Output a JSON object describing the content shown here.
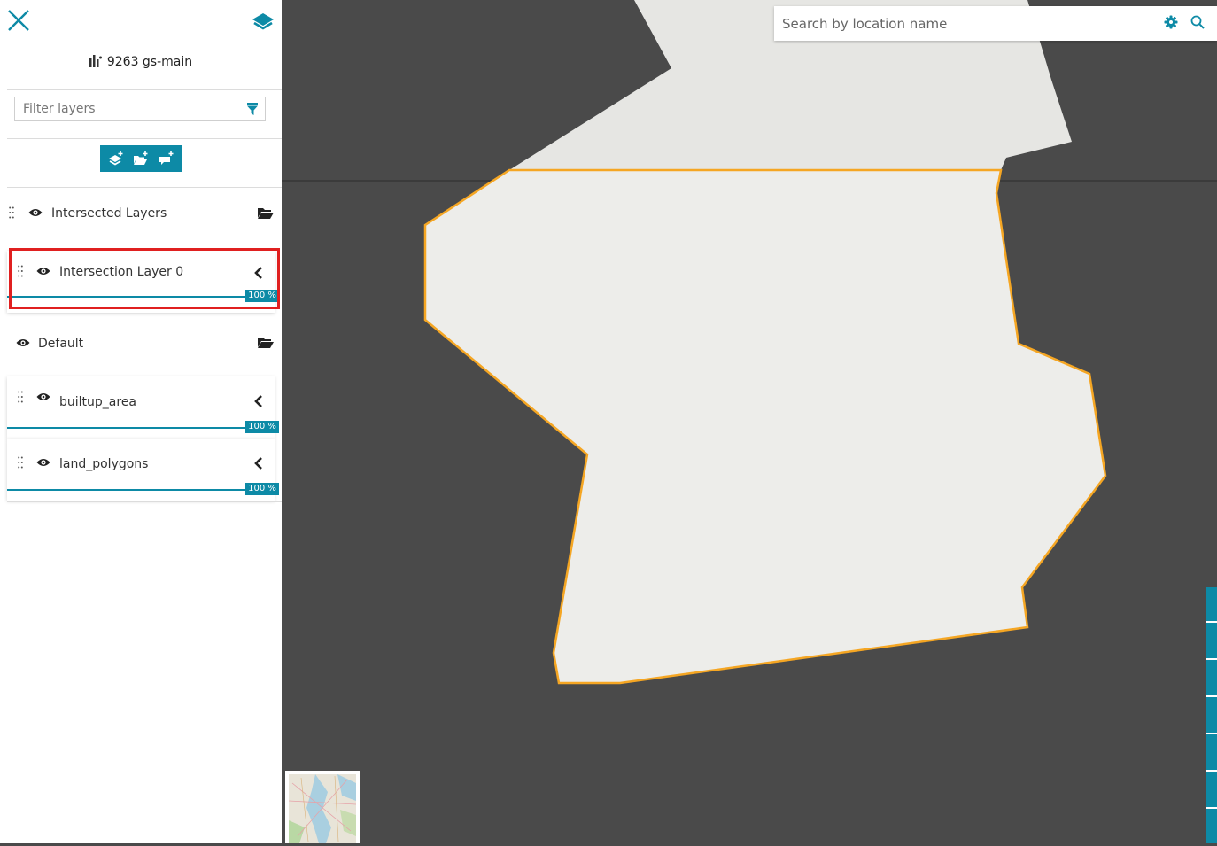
{
  "header": {
    "map_title": "9263 gs-main"
  },
  "filter": {
    "placeholder": "Filter layers"
  },
  "toolbar": {
    "buttons": [
      "add-layer",
      "add-group",
      "add-annotation"
    ]
  },
  "layers": {
    "group_intersected": {
      "label": "Intersected Layers",
      "icon": "folder-open-icon"
    },
    "intersection_layer": {
      "label": "Intersection Layer 0",
      "opacity": "100 %"
    },
    "group_default": {
      "label": "Default",
      "icon": "folder-open-icon"
    },
    "builtup_area": {
      "label": "builtup_area",
      "opacity": "100 %"
    },
    "land_polygons": {
      "label": "land_polygons",
      "opacity": "100 %"
    }
  },
  "search": {
    "placeholder": "Search by location name"
  },
  "colors": {
    "accent": "#0d8aa6",
    "map_background": "#4a4a4a",
    "polygon_fill": "#ededea",
    "polygon_stroke": "#f5a623",
    "highlight": "#e02020"
  }
}
